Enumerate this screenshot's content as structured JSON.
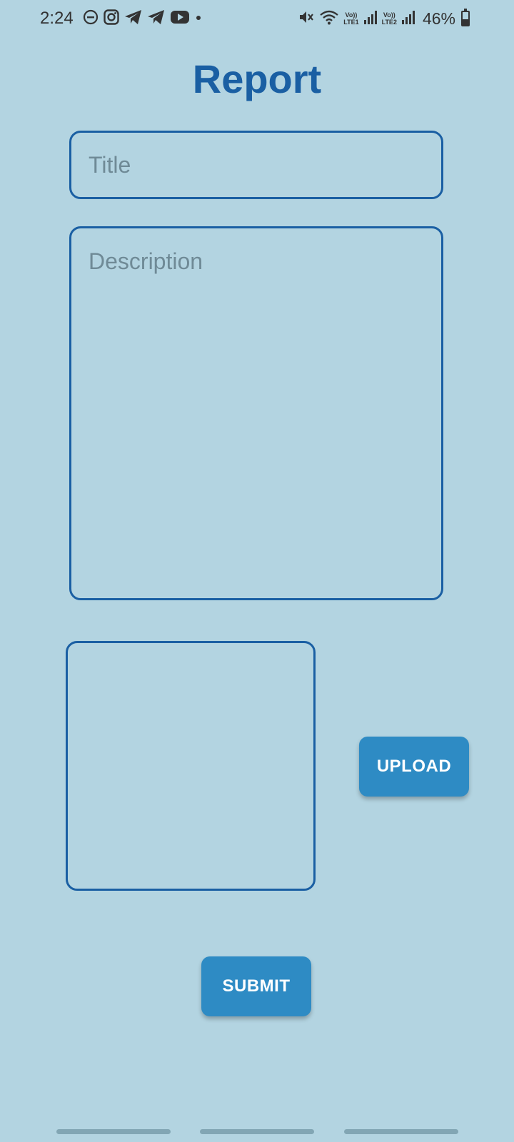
{
  "status_bar": {
    "time": "2:24",
    "sim1_top": "Vo))",
    "sim1_bottom": "LTE1",
    "sim2_top": "Vo))",
    "sim2_bottom": "LTE2",
    "battery_text": "46%",
    "battery_level": 0.46,
    "left_icons": [
      "dnd-icon",
      "instagram-icon",
      "telegram-icon",
      "telegram-icon",
      "youtube-icon",
      "dot-icon"
    ],
    "right_icons": [
      "mute-icon",
      "wifi-icon",
      "signal-icon",
      "signal-icon",
      "battery-icon"
    ]
  },
  "page": {
    "title": "Report"
  },
  "form": {
    "title_placeholder": "Title",
    "title_value": "",
    "description_placeholder": "Description",
    "description_value": "",
    "upload_label": "UPLOAD",
    "submit_label": "SUBMIT"
  },
  "colors": {
    "background": "#b3d4e1",
    "accent": "#1a5fa3",
    "button": "#2e8bc4"
  }
}
